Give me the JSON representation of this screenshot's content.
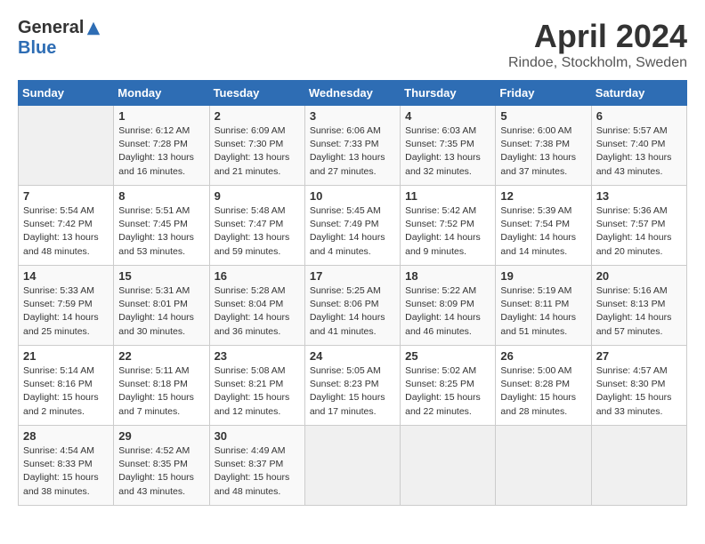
{
  "header": {
    "logo_general": "General",
    "logo_blue": "Blue",
    "month": "April 2024",
    "location": "Rindoe, Stockholm, Sweden"
  },
  "calendar": {
    "days_of_week": [
      "Sunday",
      "Monday",
      "Tuesday",
      "Wednesday",
      "Thursday",
      "Friday",
      "Saturday"
    ],
    "weeks": [
      [
        {
          "day": "",
          "info": ""
        },
        {
          "day": "1",
          "info": "Sunrise: 6:12 AM\nSunset: 7:28 PM\nDaylight: 13 hours\nand 16 minutes."
        },
        {
          "day": "2",
          "info": "Sunrise: 6:09 AM\nSunset: 7:30 PM\nDaylight: 13 hours\nand 21 minutes."
        },
        {
          "day": "3",
          "info": "Sunrise: 6:06 AM\nSunset: 7:33 PM\nDaylight: 13 hours\nand 27 minutes."
        },
        {
          "day": "4",
          "info": "Sunrise: 6:03 AM\nSunset: 7:35 PM\nDaylight: 13 hours\nand 32 minutes."
        },
        {
          "day": "5",
          "info": "Sunrise: 6:00 AM\nSunset: 7:38 PM\nDaylight: 13 hours\nand 37 minutes."
        },
        {
          "day": "6",
          "info": "Sunrise: 5:57 AM\nSunset: 7:40 PM\nDaylight: 13 hours\nand 43 minutes."
        }
      ],
      [
        {
          "day": "7",
          "info": "Sunrise: 5:54 AM\nSunset: 7:42 PM\nDaylight: 13 hours\nand 48 minutes."
        },
        {
          "day": "8",
          "info": "Sunrise: 5:51 AM\nSunset: 7:45 PM\nDaylight: 13 hours\nand 53 minutes."
        },
        {
          "day": "9",
          "info": "Sunrise: 5:48 AM\nSunset: 7:47 PM\nDaylight: 13 hours\nand 59 minutes."
        },
        {
          "day": "10",
          "info": "Sunrise: 5:45 AM\nSunset: 7:49 PM\nDaylight: 14 hours\nand 4 minutes."
        },
        {
          "day": "11",
          "info": "Sunrise: 5:42 AM\nSunset: 7:52 PM\nDaylight: 14 hours\nand 9 minutes."
        },
        {
          "day": "12",
          "info": "Sunrise: 5:39 AM\nSunset: 7:54 PM\nDaylight: 14 hours\nand 14 minutes."
        },
        {
          "day": "13",
          "info": "Sunrise: 5:36 AM\nSunset: 7:57 PM\nDaylight: 14 hours\nand 20 minutes."
        }
      ],
      [
        {
          "day": "14",
          "info": "Sunrise: 5:33 AM\nSunset: 7:59 PM\nDaylight: 14 hours\nand 25 minutes."
        },
        {
          "day": "15",
          "info": "Sunrise: 5:31 AM\nSunset: 8:01 PM\nDaylight: 14 hours\nand 30 minutes."
        },
        {
          "day": "16",
          "info": "Sunrise: 5:28 AM\nSunset: 8:04 PM\nDaylight: 14 hours\nand 36 minutes."
        },
        {
          "day": "17",
          "info": "Sunrise: 5:25 AM\nSunset: 8:06 PM\nDaylight: 14 hours\nand 41 minutes."
        },
        {
          "day": "18",
          "info": "Sunrise: 5:22 AM\nSunset: 8:09 PM\nDaylight: 14 hours\nand 46 minutes."
        },
        {
          "day": "19",
          "info": "Sunrise: 5:19 AM\nSunset: 8:11 PM\nDaylight: 14 hours\nand 51 minutes."
        },
        {
          "day": "20",
          "info": "Sunrise: 5:16 AM\nSunset: 8:13 PM\nDaylight: 14 hours\nand 57 minutes."
        }
      ],
      [
        {
          "day": "21",
          "info": "Sunrise: 5:14 AM\nSunset: 8:16 PM\nDaylight: 15 hours\nand 2 minutes."
        },
        {
          "day": "22",
          "info": "Sunrise: 5:11 AM\nSunset: 8:18 PM\nDaylight: 15 hours\nand 7 minutes."
        },
        {
          "day": "23",
          "info": "Sunrise: 5:08 AM\nSunset: 8:21 PM\nDaylight: 15 hours\nand 12 minutes."
        },
        {
          "day": "24",
          "info": "Sunrise: 5:05 AM\nSunset: 8:23 PM\nDaylight: 15 hours\nand 17 minutes."
        },
        {
          "day": "25",
          "info": "Sunrise: 5:02 AM\nSunset: 8:25 PM\nDaylight: 15 hours\nand 22 minutes."
        },
        {
          "day": "26",
          "info": "Sunrise: 5:00 AM\nSunset: 8:28 PM\nDaylight: 15 hours\nand 28 minutes."
        },
        {
          "day": "27",
          "info": "Sunrise: 4:57 AM\nSunset: 8:30 PM\nDaylight: 15 hours\nand 33 minutes."
        }
      ],
      [
        {
          "day": "28",
          "info": "Sunrise: 4:54 AM\nSunset: 8:33 PM\nDaylight: 15 hours\nand 38 minutes."
        },
        {
          "day": "29",
          "info": "Sunrise: 4:52 AM\nSunset: 8:35 PM\nDaylight: 15 hours\nand 43 minutes."
        },
        {
          "day": "30",
          "info": "Sunrise: 4:49 AM\nSunset: 8:37 PM\nDaylight: 15 hours\nand 48 minutes."
        },
        {
          "day": "",
          "info": ""
        },
        {
          "day": "",
          "info": ""
        },
        {
          "day": "",
          "info": ""
        },
        {
          "day": "",
          "info": ""
        }
      ]
    ]
  }
}
